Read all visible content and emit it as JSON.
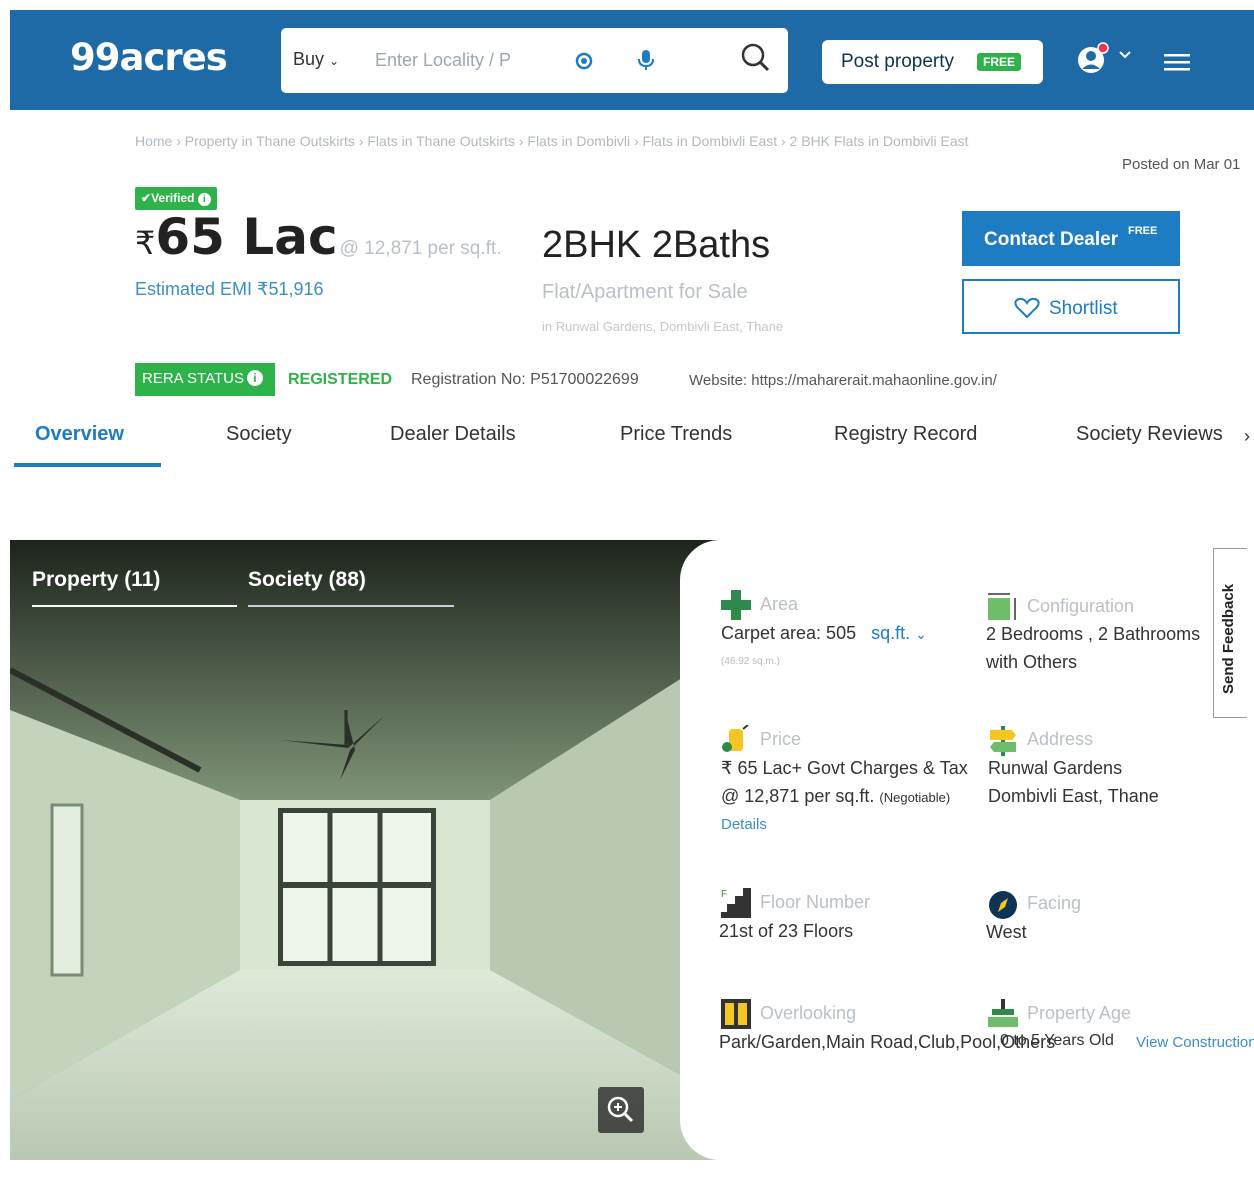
{
  "header": {
    "logo": "99acres",
    "search_mode": "Buy",
    "search_placeholder": "Enter Locality / P",
    "post_property_label": "Post property",
    "post_property_badge": "FREE",
    "brand_color": "#1d6aa6"
  },
  "breadcrumb": "Home › Property in Thane Outskirts › Flats in Thane Outskirts › Flats in Dombivli › Flats in Dombivli East › 2 BHK Flats in Dombivli East",
  "posted_on": "Posted on Mar 01",
  "listing": {
    "verified_label": "Verified",
    "currency": "₹",
    "price": "65 Lac",
    "price_per_sqft": "@ 12,871 per sq.ft.",
    "emi": "Estimated EMI ₹51,916",
    "title": "2BHK 2Baths",
    "subtitle": "Flat/Apartment for Sale",
    "location": "in Runwal Gardens, Dombivli East, Thane",
    "contact_label": "Contact Dealer",
    "contact_badge": "FREE",
    "shortlist_label": "Shortlist"
  },
  "rera": {
    "label": "RERA STATUS",
    "status": "REGISTERED",
    "registration": "Registration No: P51700022699",
    "website": "Website: https://maharerait.mahaonline.gov.in/"
  },
  "tabs": [
    "Overview",
    "Society",
    "Dealer Details",
    "Price Trends",
    "Registry Record",
    "Society Reviews"
  ],
  "gallery": {
    "tab_property": "Property (11)",
    "tab_society": "Society (88)"
  },
  "details": {
    "area_label": "Area",
    "area_value": "Carpet area: 505",
    "area_unit": "sq.ft.",
    "area_sub": "(46.92 sq.m.)",
    "config_label": "Configuration",
    "config_value_1": "2 Bedrooms , 2 Bathrooms",
    "config_value_2": "with Others",
    "price_label": "Price",
    "price_value_1": "₹ 65 Lac+ Govt Charges & Tax",
    "price_value_2": "@ 12,871 per sq.ft.",
    "price_negotiable": "(Negotiable)",
    "price_link": "Details",
    "address_label": "Address",
    "address_value_1": "Runwal Gardens",
    "address_value_2": "Dombivli East, Thane",
    "floor_label": "Floor Number",
    "floor_value": "21st  of 23 Floors",
    "facing_label": "Facing",
    "facing_value": "West",
    "overlooking_label": "Overlooking",
    "overlooking_value": "Park/Garden,Main Road,Club,Pool,Others",
    "age_label": "Property Age",
    "age_value": "0 to 5 Years Old",
    "age_link": "View Construction"
  },
  "feedback_label": "Send Feedback"
}
